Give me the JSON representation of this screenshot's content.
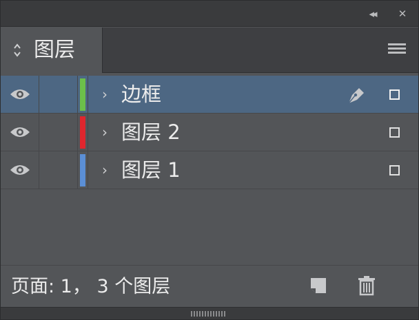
{
  "panel": {
    "tab_label": "图层",
    "collapse_icon": "double-chevron-left-icon",
    "close_icon": "close-icon",
    "menu_icon": "hamburger-menu-icon"
  },
  "layers": [
    {
      "name": "边框",
      "color": "#6cc04a",
      "selected": true,
      "visible": true,
      "has_pen": true
    },
    {
      "name": "图层 2",
      "color": "#e0262e",
      "selected": false,
      "visible": true,
      "has_pen": false
    },
    {
      "name": "图层 1",
      "color": "#5b8fd6",
      "selected": false,
      "visible": true,
      "has_pen": false
    }
  ],
  "footer": {
    "status": "页面: 1， 3 个图层",
    "new_layer_icon": "new-layer-icon",
    "delete_icon": "trash-icon"
  },
  "colors": {
    "panel_bg": "#535558",
    "selected_row": "#4d6783",
    "titlebar": "#3a3b3d"
  }
}
